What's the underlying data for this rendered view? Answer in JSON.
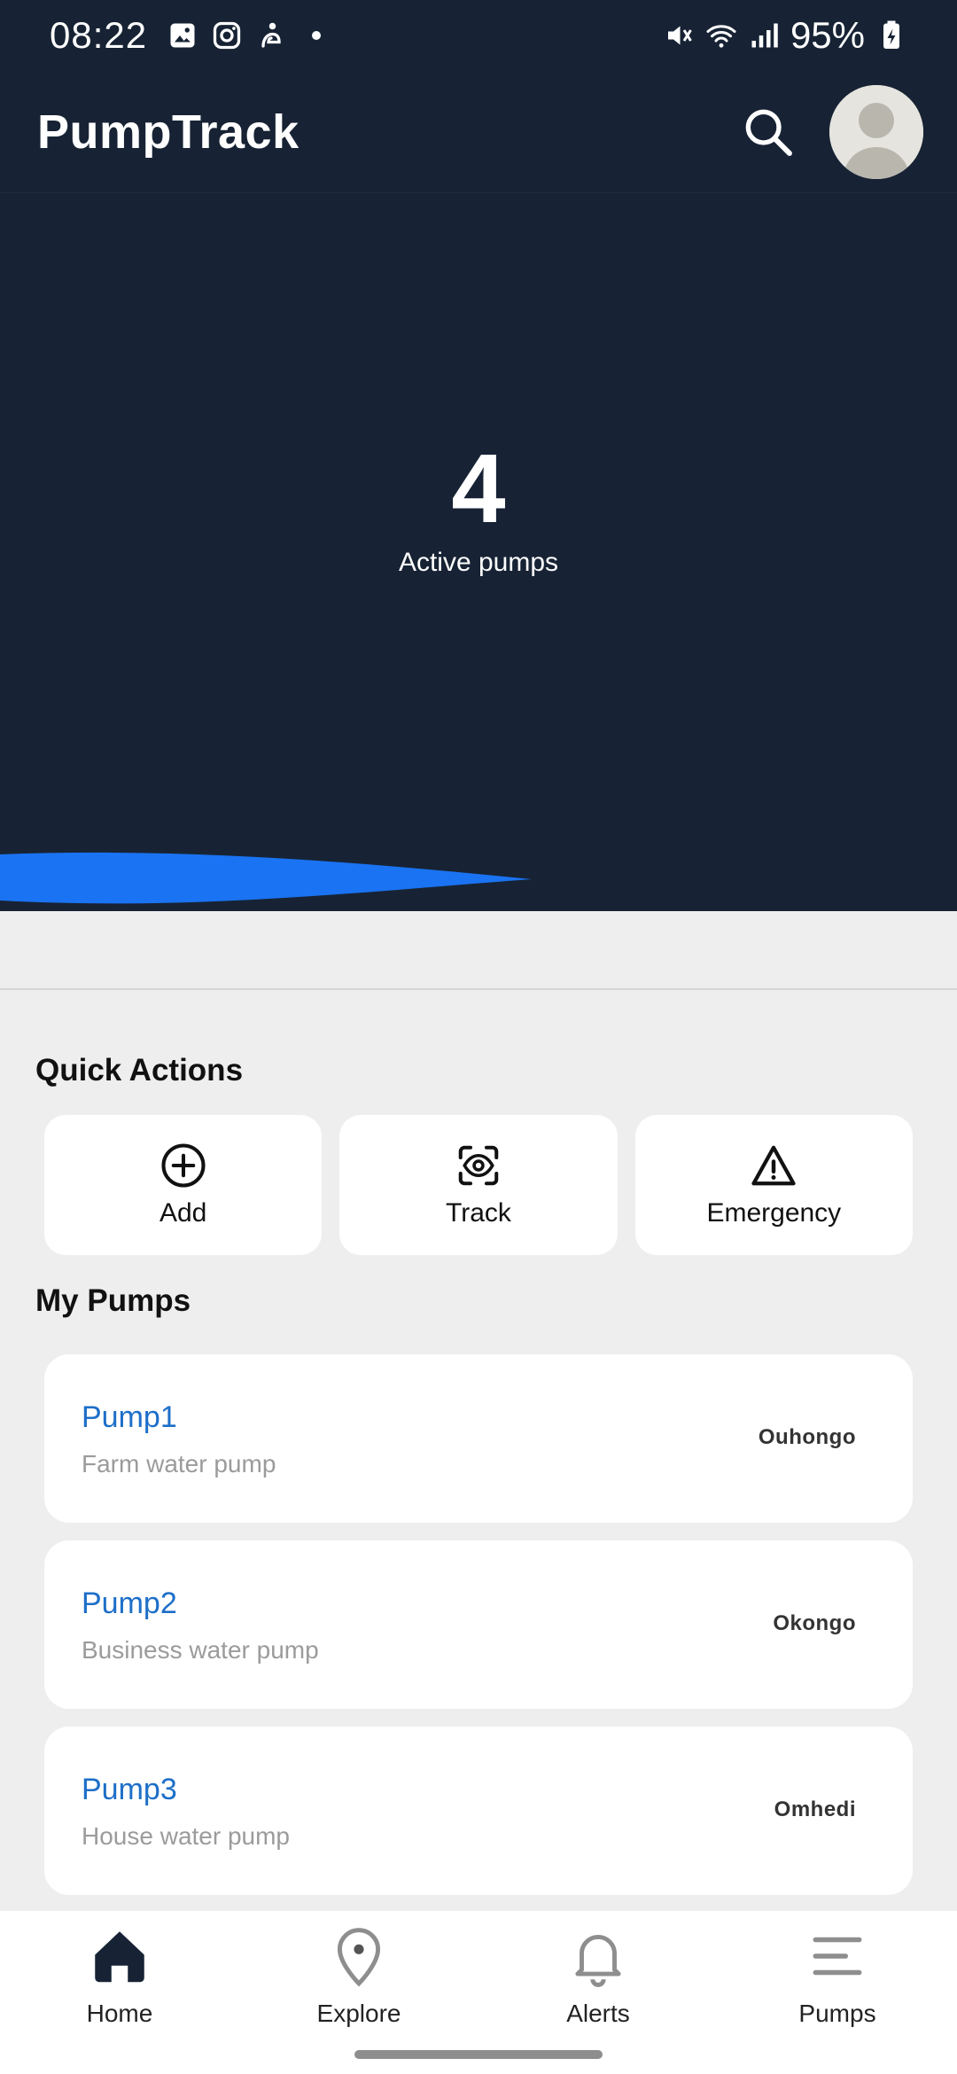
{
  "status_bar": {
    "time": "08:22",
    "battery": "95%",
    "icons": [
      "gallery-icon",
      "instagram-icon",
      "notification-icon",
      "mute-icon",
      "wifi-icon",
      "signal-icon",
      "battery-charging-icon"
    ]
  },
  "app_bar": {
    "title": "PumpTrack",
    "search_icon": "search-icon",
    "avatar_icon": "avatar"
  },
  "hero": {
    "count": "4",
    "label": "Active pumps"
  },
  "quick_actions": {
    "title": "Quick Actions",
    "items": [
      {
        "label": "Add",
        "icon": "add-circle-icon"
      },
      {
        "label": "Track",
        "icon": "track-scan-icon"
      },
      {
        "label": "Emergency",
        "icon": "warning-icon"
      }
    ]
  },
  "my_pumps": {
    "title": "My Pumps",
    "items": [
      {
        "name": "Pump1",
        "description": "Farm water pump",
        "location": "Ouhongo"
      },
      {
        "name": "Pump2",
        "description": "Business water pump",
        "location": "Okongo"
      },
      {
        "name": "Pump3",
        "description": "House water pump",
        "location": "Omhedi"
      }
    ]
  },
  "bottom_nav": {
    "items": [
      {
        "label": "Home",
        "icon": "home-icon"
      },
      {
        "label": "Explore",
        "icon": "location-pin-icon"
      },
      {
        "label": "Alerts",
        "icon": "bell-icon"
      },
      {
        "label": "Pumps",
        "icon": "menu-lines-icon"
      }
    ]
  },
  "colors": {
    "header_bg": "#172334",
    "accent_blue": "#1e6fc8",
    "wave_blue": "#1a73f2",
    "page_bg": "#eeeeee"
  }
}
